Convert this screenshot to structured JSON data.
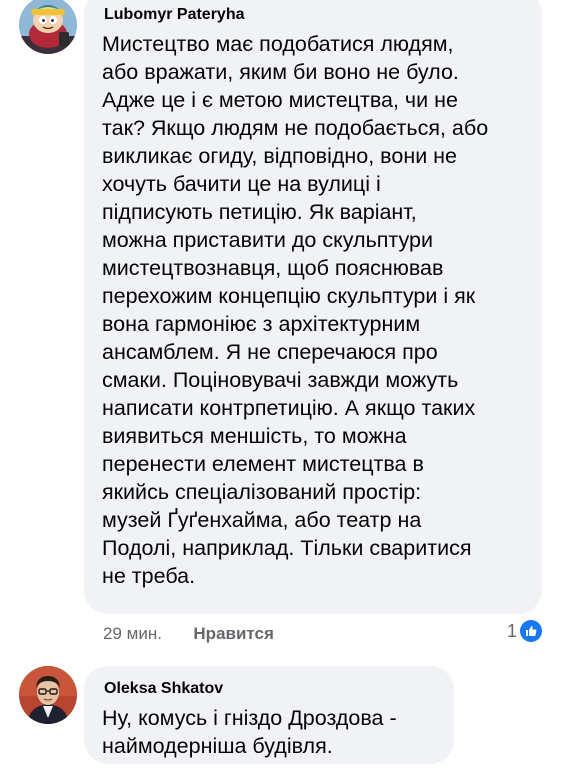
{
  "comments": [
    {
      "author": "Lubomyr Pateryha",
      "lines": [
        "Мистецтво має подобатися людям,",
        "або вражати, яким би воно не було.",
        "Адже це і є метою мистецтва, чи не",
        "так? Якщо людям не подобається, або",
        "викликає огиду, відповідно, вони не",
        "хочуть бачити це на вулиці і",
        "підписують петицію. Як варіант,",
        "можна приставити до скульптури",
        "мистецтвознавця, щоб пояснював",
        "перехожим концепцію скульптури і як",
        "вона гармоніює з архітектурним",
        "ансамблем. Я не сперечаюся про",
        "смаки. Поціновувачі завжди можуть",
        "написати контрпетицію. А якщо таких",
        "виявиться меншість, то можна",
        "перенести елемент мистецтва в",
        "якийсь спеціалізований простір:",
        "музей Ґуґенхайма, або театр на",
        "Подолі, наприклад. Тільки сваритися",
        "не треба."
      ],
      "time": "29 мин.",
      "like_label": "Нравится",
      "reaction_count": "1",
      "reaction_icon": "like-icon",
      "avatar_icon": "cartoon-avatar-icon"
    },
    {
      "author": "Oleksa Shkatov",
      "lines": [
        "Ну, комусь і гніздо Дроздова -",
        "наймодерніша будівля."
      ],
      "avatar_icon": "photo-avatar-icon"
    }
  ],
  "colors": {
    "bubble": "#f0f2f5",
    "text": "#050505",
    "meta": "#65676b",
    "like_blue": "#1877f2"
  }
}
